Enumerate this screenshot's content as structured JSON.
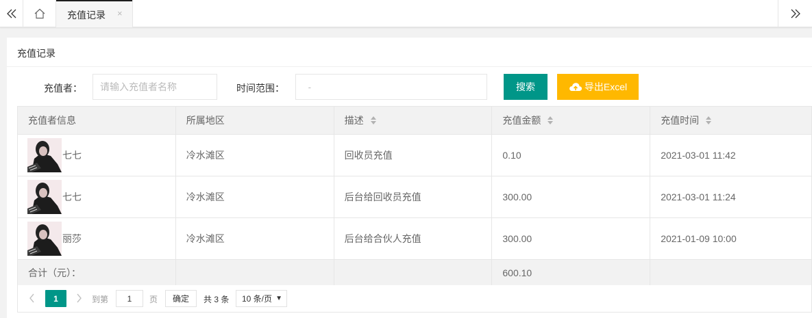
{
  "tabs": {
    "active_label": "充值记录",
    "close_glyph": "×"
  },
  "card": {
    "title": "充值记录"
  },
  "filters": {
    "recharger_label": "充值者：",
    "recharger_placeholder": "请输入充值者名称",
    "range_label": "时间范围：",
    "range_placeholder": " - ",
    "search_label": "搜索",
    "export_label": "导出Excel"
  },
  "table": {
    "headers": [
      "充值者信息",
      "所属地区",
      "描述",
      "充值金额",
      "充值时间"
    ],
    "rows": [
      {
        "name": "七七",
        "region": "冷水滩区",
        "desc": "回收员充值",
        "amount": "0.10",
        "time": "2021-03-01 11:42"
      },
      {
        "name": "七七",
        "region": "冷水滩区",
        "desc": "后台给回收员充值",
        "amount": "300.00",
        "time": "2021-03-01 11:24"
      },
      {
        "name": "丽莎",
        "region": "冷水滩区",
        "desc": "后台给合伙人充值",
        "amount": "300.00",
        "time": "2021-01-09 10:00"
      }
    ],
    "footer": {
      "label": "合计（元）：",
      "total": "600.10"
    }
  },
  "pagination": {
    "current_page": "1",
    "goto_label": "到第",
    "goto_value": "1",
    "page_unit": "页",
    "confirm_label": "确定",
    "total_label": "共 3 条",
    "page_size": "10 条/页"
  },
  "icons": {
    "tab_left": "double-chevron-left-icon",
    "home": "home-icon",
    "tab_right": "double-chevron-right-icon",
    "export": "cloud-upload-icon"
  },
  "colors": {
    "primary": "#009688",
    "warning": "#ffb800"
  }
}
